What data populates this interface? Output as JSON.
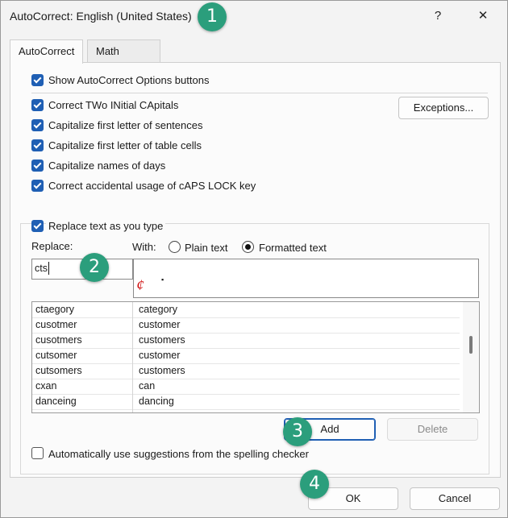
{
  "window": {
    "title": "AutoCorrect: English (United States)",
    "help_glyph": "?",
    "close_glyph": "✕"
  },
  "tabs": [
    {
      "label": "AutoCorrect",
      "active": true
    },
    {
      "label": "Math AutoCorrect",
      "active": false
    }
  ],
  "options": {
    "show_buttons": "Show AutoCorrect Options buttons",
    "two_initials": "Correct TWo INitial CApitals",
    "cap_sentences": "Capitalize first letter of sentences",
    "cap_table": "Capitalize first letter of table cells",
    "cap_days": "Capitalize names of days",
    "caps_lock": "Correct accidental usage of cAPS LOCK key"
  },
  "exceptions_label": "Exceptions...",
  "replace_group": {
    "replace_as_type": "Replace text as you type",
    "replace_label": "Replace:",
    "with_label": "With:",
    "plain_text": "Plain text",
    "formatted_text": "Formatted text",
    "replace_value": "cts",
    "with_value": "¢",
    "bullet_glyph": "▪"
  },
  "table": [
    {
      "from": "ctaegory",
      "to": "category"
    },
    {
      "from": "cusotmer",
      "to": "customer"
    },
    {
      "from": "cusotmers",
      "to": "customers"
    },
    {
      "from": "cutsomer",
      "to": "customer"
    },
    {
      "from": "cutsomers",
      "to": "customers"
    },
    {
      "from": "cxan",
      "to": "can"
    },
    {
      "from": "danceing",
      "to": "dancing"
    }
  ],
  "buttons": {
    "add": "Add",
    "delete": "Delete",
    "ok": "OK",
    "cancel": "Cancel"
  },
  "suggestions_label": "Automatically use suggestions from the spelling checker",
  "badges": {
    "b1": "1",
    "b2": "2",
    "b3": "3",
    "b4": "4"
  },
  "colors": {
    "accent": "#1f5fb4",
    "badge": "#2b9e7c",
    "cent_red": "#d01010"
  }
}
